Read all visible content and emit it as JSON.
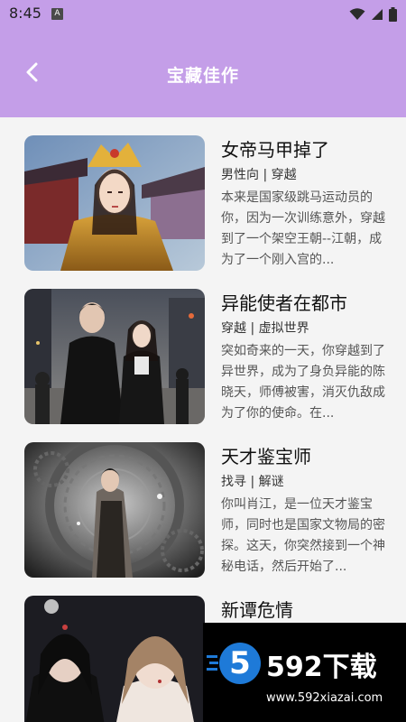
{
  "status_bar": {
    "time": "8:45",
    "notification_badge": "A",
    "icons": [
      "wifi-icon",
      "signal-icon",
      "battery-icon"
    ]
  },
  "header": {
    "title": "宝藏佳作",
    "back_icon": "chevron-left-icon",
    "background_color": "#c49ee8"
  },
  "books": [
    {
      "title": "女帝马甲掉了",
      "tags": "男性向 | 穿越",
      "description": "本来是国家级跳马运动员的你，因为一次训练意外，穿越到了一个架空王朝--江朝，成为了一个刚入宫的..."
    },
    {
      "title": "异能使者在都市",
      "tags": "穿越 | 虚拟世界",
      "description": "突如奇来的一天，你穿越到了异世界，成为了身负异能的陈晓天，师傅被害，消灭仇敌成为了你的使命。在..."
    },
    {
      "title": "天才鉴宝师",
      "tags": "找寻 | 解谜",
      "description": "你叫肖江，是一位天才鉴宝师，同时也是国家文物局的密探。这天，你突然接到一个神秘电话，然后开始了..."
    },
    {
      "title": "新谭危情",
      "tags": "",
      "description": ""
    }
  ],
  "watermark": {
    "logo_glyph": "5",
    "brand": "592下载",
    "url": "www.592xiazai.com"
  }
}
